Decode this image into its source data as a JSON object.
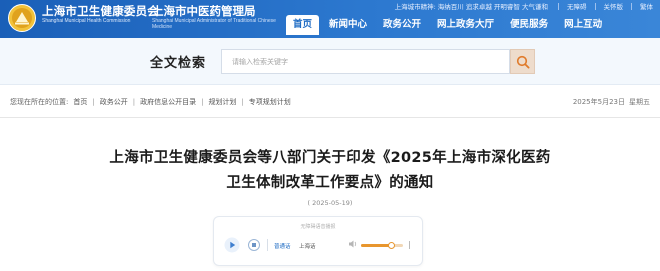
{
  "header": {
    "org_name": "上海市卫生健康委员会",
    "org_name_en": "Shanghai Municipal Health Commission",
    "org_name2": "上海市中医药管理局",
    "org_name2_en": "Shanghai Municipal Administrator of Traditional Chinese Medicine",
    "util": {
      "motto_label": "上海城市精神:",
      "motto": "海纳百川 追求卓越 开明睿智 大气谦和",
      "accessibility": "无障碍",
      "care_mode": "关怀版",
      "traditional": "繁体"
    },
    "nav": [
      "首页",
      "新闻中心",
      "政务公开",
      "网上政务大厅",
      "便民服务",
      "网上互动"
    ],
    "accent": "#1f6cc4"
  },
  "search": {
    "title": "全文检索",
    "placeholder": "请输入检索关键字",
    "button_icon": "search-icon"
  },
  "breadcrumb": {
    "label": "您现在所在的位置:",
    "items": [
      "首页",
      "政务公开",
      "政府信息公开目录",
      "规划计划",
      "专项规划计划"
    ],
    "date": "2025年5月23日",
    "weekday": "星期五"
  },
  "article": {
    "title_line1": "上海市卫生健康委员会等八部门关于印发《2025年上海市深化医药",
    "title_line2": "卫生体制改革工作要点》的通知",
    "date": "( 2025-05-19)"
  },
  "player": {
    "title": "无障碍语音播报",
    "voice_standard": "普通话",
    "voice_shanghai": "上海话",
    "volume": 0.72
  }
}
